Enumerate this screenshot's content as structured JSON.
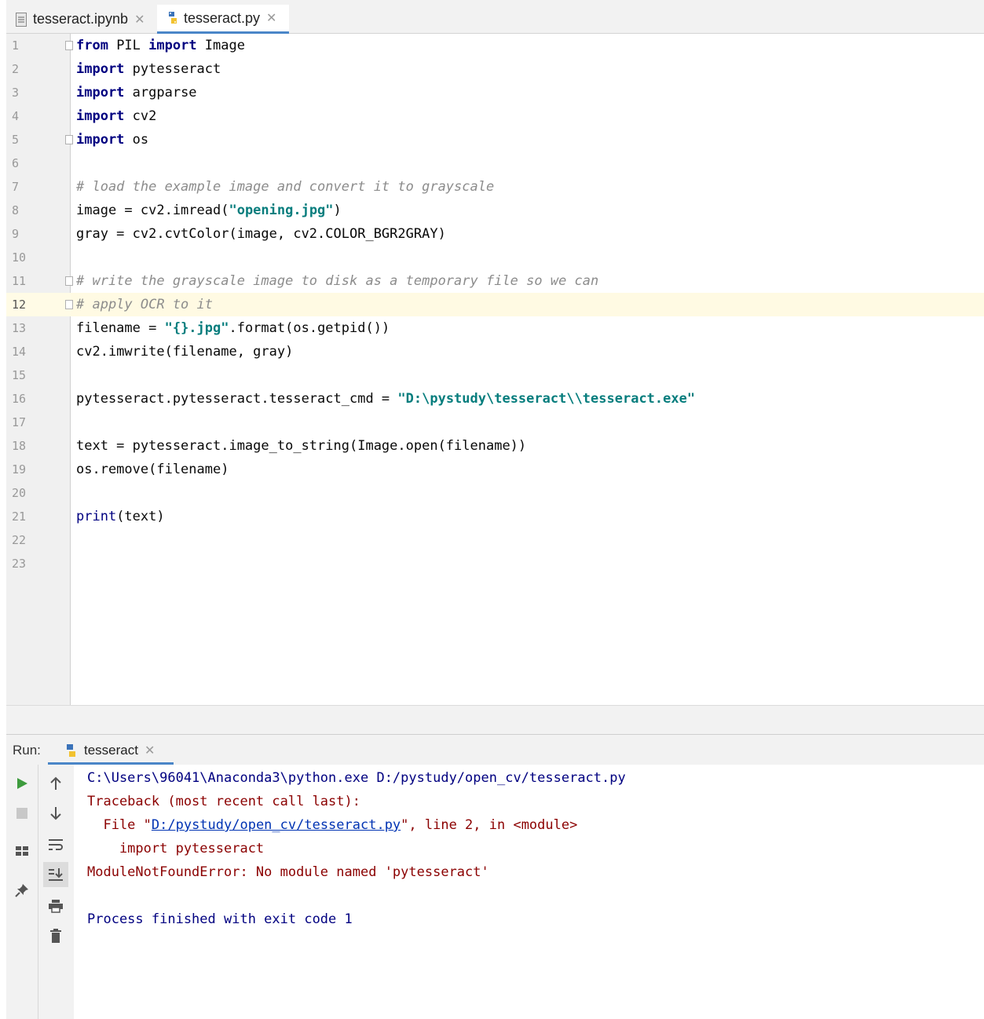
{
  "tabs": [
    {
      "label": "tesseract.ipynb",
      "active": false
    },
    {
      "label": "tesseract.py",
      "active": true
    }
  ],
  "editor": {
    "current_line": 12,
    "line_numbers": [
      "1",
      "2",
      "3",
      "4",
      "5",
      "6",
      "7",
      "8",
      "9",
      "10",
      "11",
      "12",
      "13",
      "14",
      "15",
      "16",
      "17",
      "18",
      "19",
      "20",
      "21",
      "22",
      "23"
    ]
  },
  "run": {
    "label": "Run:",
    "tab_label": "tesseract",
    "output": {
      "cmd": "C:\\Users\\96041\\Anaconda3\\python.exe D:/pystudy/open_cv/tesseract.py",
      "traceback": "Traceback (most recent call last):",
      "file_prefix": "  File \"",
      "file_link": "D:/pystudy/open_cv/tesseract.py",
      "file_suffix": "\", line 2, in <module>",
      "src": "    import pytesseract",
      "error": "ModuleNotFoundError: No module named 'pytesseract'",
      "exit": "Process finished with exit code 1"
    }
  },
  "icons": [
    "python-file-icon",
    "notebook-file-icon",
    "run-icon",
    "stop-icon",
    "layout-icon",
    "pin-icon",
    "up-arrow-icon",
    "down-arrow-icon",
    "soft-wrap-icon",
    "scroll-to-end-icon",
    "print-icon",
    "trash-icon"
  ],
  "colors": {
    "accent": "#4a86c8",
    "run_green": "#3d9b3d",
    "error_text": "#8b0000",
    "keyword": "#000080"
  }
}
